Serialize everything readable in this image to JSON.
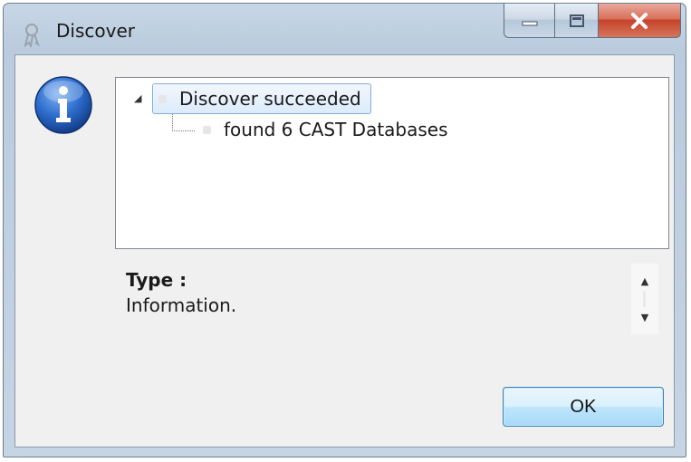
{
  "window": {
    "title": "Discover",
    "icon": "cast-ribbon-icon"
  },
  "caption": {
    "minimize_icon": "minimize-icon",
    "maximize_icon": "maximize-icon",
    "close_icon": "close-icon",
    "close_color": "#c4432a"
  },
  "message": {
    "icon": "information-icon",
    "icon_color": "#1f5fb4",
    "tree": {
      "root_label": "Discover succeeded",
      "children": [
        "found 6 CAST Databases"
      ]
    },
    "type_label": "Type :",
    "type_value": "Information."
  },
  "buttons": {
    "ok_label": "OK"
  }
}
